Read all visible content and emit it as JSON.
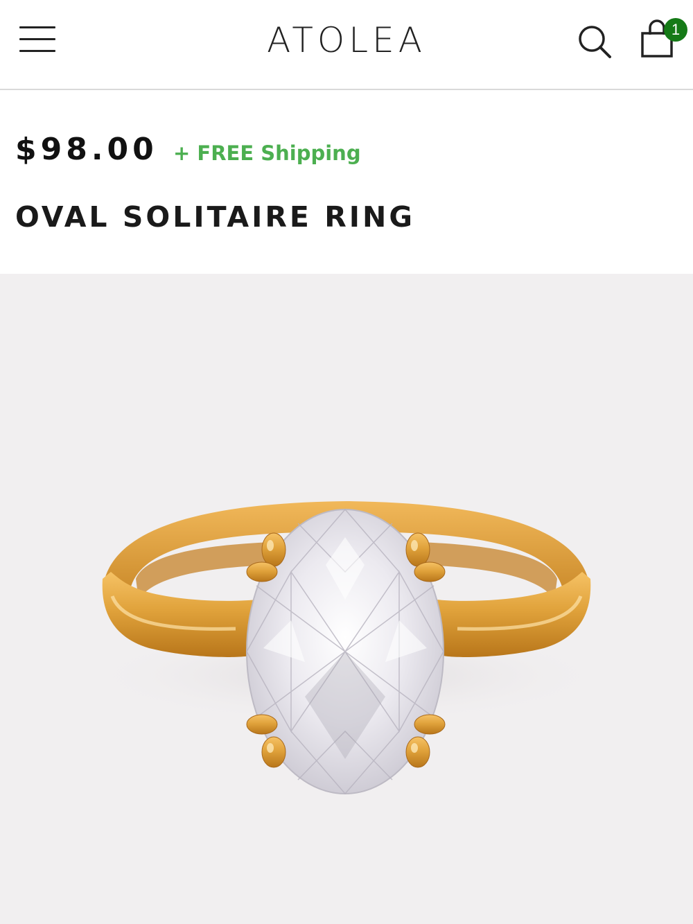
{
  "header": {
    "logo_text": "ATOLEA",
    "cart_count": "1",
    "icons": {
      "menu": "hamburger-menu-icon",
      "search": "search-icon",
      "cart": "shopping-bag-icon"
    }
  },
  "product": {
    "price": "$98.00",
    "shipping_note": "+ FREE Shipping",
    "title": "OVAL SOLITAIRE RING",
    "image_subject": "gold solitaire ring with oval clear stone"
  },
  "colors": {
    "accent_green": "#4caf50",
    "badge_green": "#157a17",
    "image_background": "#f1eff0",
    "gold": "#d99a2b"
  }
}
